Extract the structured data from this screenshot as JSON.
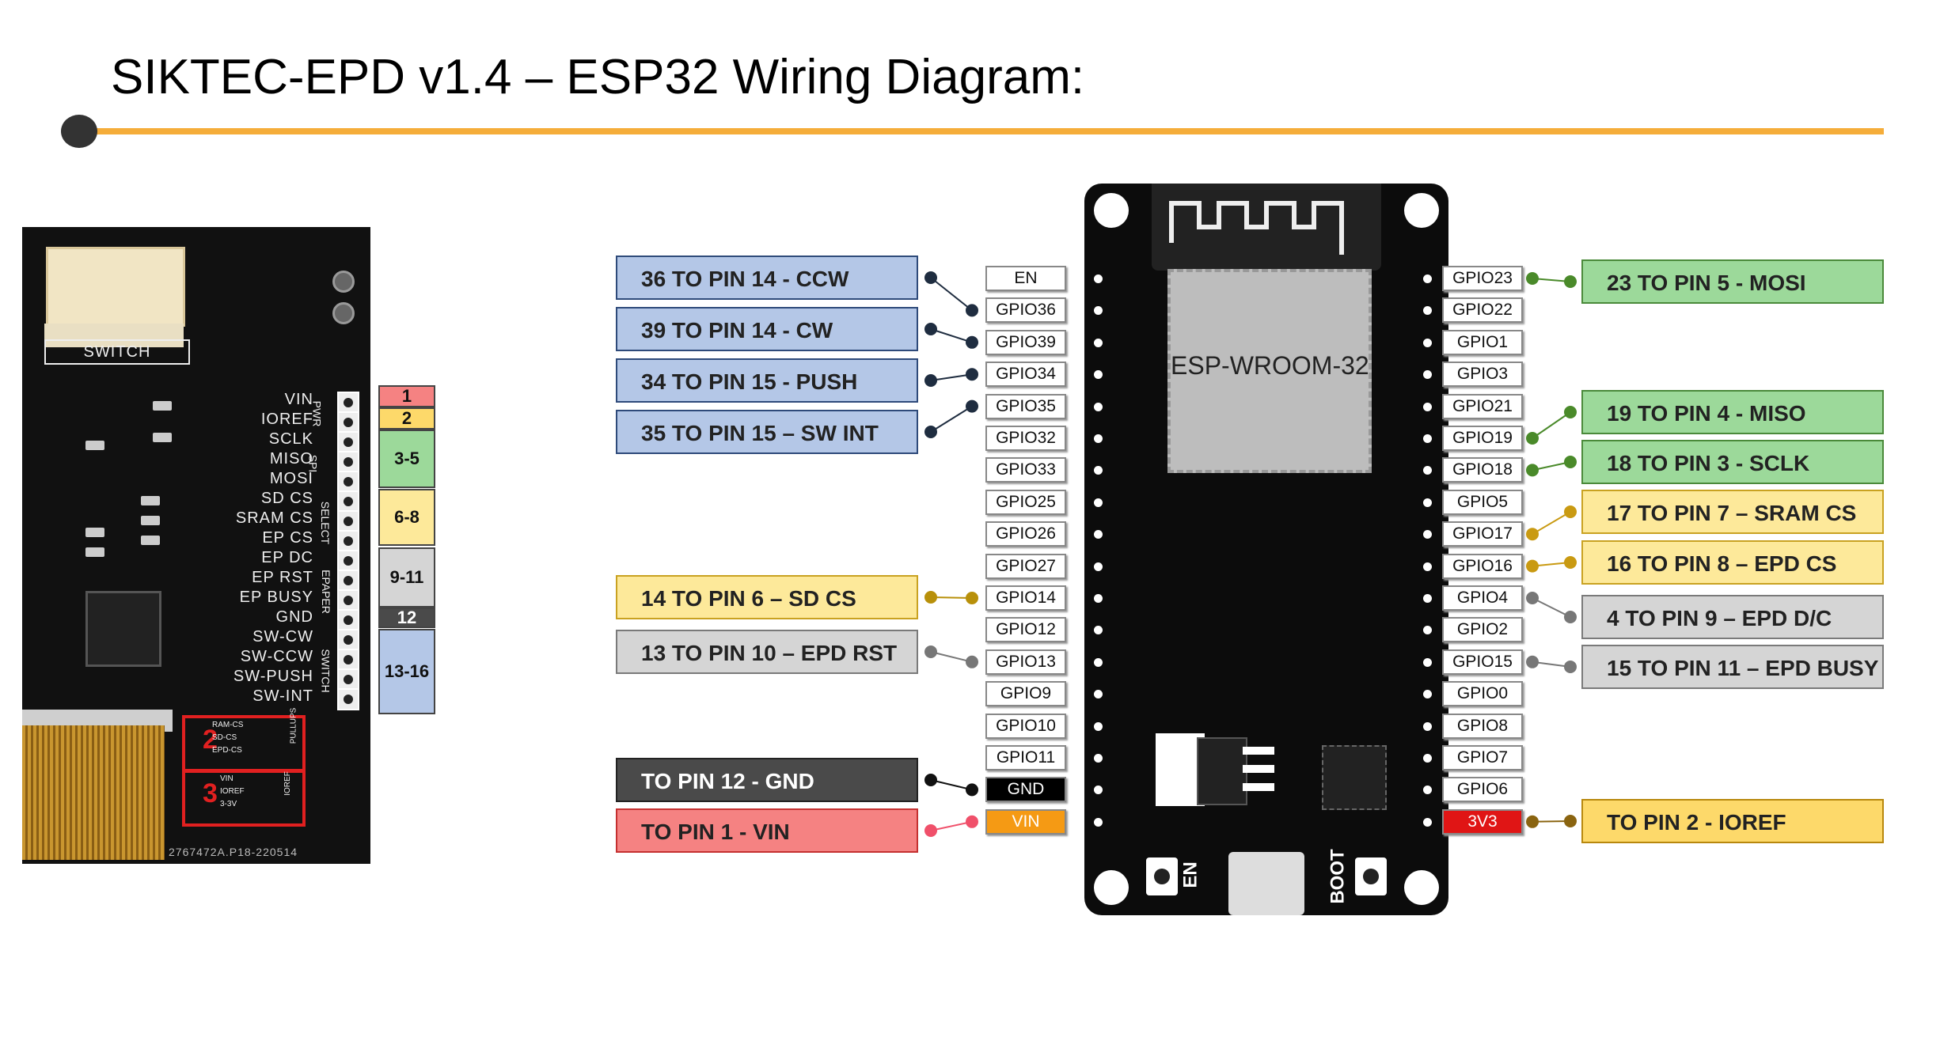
{
  "title": "SIKTEC-EPD v1.4 – ESP32 Wiring Diagram:",
  "epd_board": {
    "switch_label": "SWITCH",
    "silk_pins": [
      "VIN",
      "IOREF",
      "SCLK",
      "MISO",
      "MOSI",
      "SD CS",
      "SRAM CS",
      "EP CS",
      "EP DC",
      "EP RST",
      "EP BUSY",
      "GND",
      "SW-CW",
      "SW-CCW",
      "SW-PUSH",
      "SW-INT"
    ],
    "group_labels": [
      "PWR",
      "SPI",
      "SELECT",
      "EPAPER",
      "SWITCH"
    ],
    "bridge_box_1": {
      "number": "2",
      "labels": [
        "RAM-CS",
        "SD-CS",
        "EPD-CS"
      ],
      "tag": "PULLUPS"
    },
    "bridge_box_2": {
      "number": "3",
      "labels": [
        "VIN",
        "IOREF",
        "3-3V"
      ],
      "tag": "IOREF"
    },
    "part_number": "2767472A.P18-220514"
  },
  "pin_groups": [
    {
      "label": "1",
      "color": "#f58282"
    },
    {
      "label": "2",
      "color": "#fdd96a"
    },
    {
      "label": "3-5",
      "color": "#9cd99a"
    },
    {
      "label": "6-8",
      "color": "#fde99a"
    },
    {
      "label": "9-11",
      "color": "#d5d5d5"
    },
    {
      "label": "12",
      "color": "#4a4a4a"
    },
    {
      "label": "13-16",
      "color": "#b4c7e7"
    }
  ],
  "esp32": {
    "module_label": "ESP-WROOM-32",
    "en_button": "EN",
    "boot_button": "BOOT",
    "left_pins": [
      "EN",
      "GPIO36",
      "GPIO39",
      "GPIO34",
      "GPIO35",
      "GPIO32",
      "GPIO33",
      "GPIO25",
      "GPIO26",
      "GPIO27",
      "GPIO14",
      "GPIO12",
      "GPIO13",
      "GPIO9",
      "GPIO10",
      "GPIO11",
      "GND",
      "VIN"
    ],
    "right_pins": [
      "GPIO23",
      "GPIO22",
      "GPIO1",
      "GPIO3",
      "GPIO21",
      "GPIO19",
      "GPIO18",
      "GPIO5",
      "GPIO17",
      "GPIO16",
      "GPIO4",
      "GPIO2",
      "GPIO15",
      "GPIO0",
      "GPIO8",
      "GPIO7",
      "GPIO6",
      "3V3"
    ]
  },
  "connections_left": [
    {
      "text": "36 TO PIN 14 - CCW",
      "style": "blue",
      "wire": "#1f2d40"
    },
    {
      "text": "39 TO PIN 14 - CW",
      "style": "blue",
      "wire": "#1f2d40"
    },
    {
      "text": "34 TO PIN 15 - PUSH",
      "style": "blue",
      "wire": "#1f2d40"
    },
    {
      "text": "35 TO PIN 15 – SW INT",
      "style": "blue",
      "wire": "#1f2d40"
    },
    {
      "text": "14 TO PIN 6 – SD CS",
      "style": "yellow",
      "wire": "#b8900a"
    },
    {
      "text": "13 TO PIN 10 – EPD RST",
      "style": "gray",
      "wire": "#777777"
    },
    {
      "text": "TO PIN 12 - GND",
      "style": "dark",
      "wire": "#111111"
    },
    {
      "text": "TO PIN 1 - VIN",
      "style": "red",
      "wire": "#f0506a"
    }
  ],
  "connections_right": [
    {
      "text": "23 TO PIN 5 - MOSI",
      "style": "green",
      "wire": "#4a8a2a"
    },
    {
      "text": "19 TO PIN 4 - MISO",
      "style": "green",
      "wire": "#4a8a2a"
    },
    {
      "text": "18 TO PIN 3 - SCLK",
      "style": "green",
      "wire": "#4a8a2a"
    },
    {
      "text": "17 TO PIN 7 – SRAM CS",
      "style": "yellow",
      "wire": "#c99a12"
    },
    {
      "text": "16 TO PIN 8 – EPD CS",
      "style": "yellow",
      "wire": "#c99a12"
    },
    {
      "text": "4 TO PIN 9 – EPD D/C",
      "style": "gray",
      "wire": "#777777"
    },
    {
      "text": "15 TO PIN 11 – EPD BUSY",
      "style": "gray",
      "wire": "#777777"
    },
    {
      "text": "TO PIN 2 - IOREF",
      "style": "gold",
      "wire": "#8a6410"
    }
  ]
}
